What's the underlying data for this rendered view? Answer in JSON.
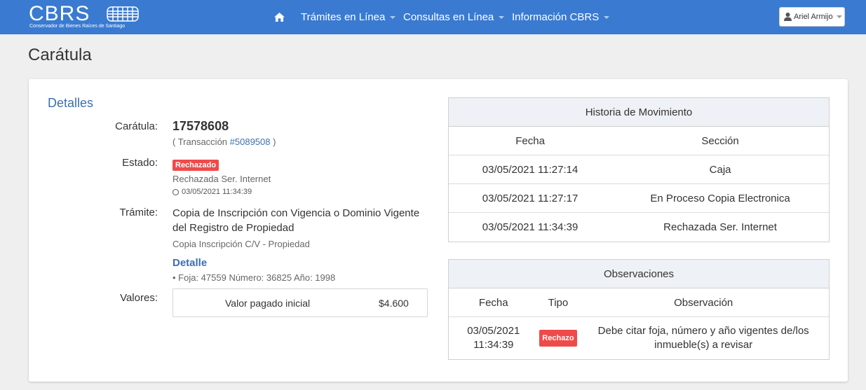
{
  "navbar": {
    "logo_text": "CBRS",
    "logo_subtitle": "Conservador de Bienes Raíces de Santiago",
    "home_icon": "home-icon",
    "menus": [
      "Trámites en Línea",
      "Consultas en Línea",
      "Información CBRS"
    ],
    "user_name": "Ariel Armijo",
    "user_icon": "user-icon"
  },
  "page": {
    "title": "Carátula",
    "section_title": "Detalles"
  },
  "details": {
    "caratula_label": "Carátula:",
    "caratula_number": "17578608",
    "transaccion_prefix": "( Transacción ",
    "transaccion_link": "#5089508",
    "transaccion_suffix": " )",
    "estado_label": "Estado:",
    "estado_badge": "Rechazado",
    "estado_detail": "Rechazada Ser. Internet",
    "estado_time": "03/05/2021 11:34:39",
    "tramite_label": "Trámite:",
    "tramite_title": "Copia de Inscripción con Vigencia o Dominio Vigente del Registro de Propiedad",
    "tramite_sub": "Copia Inscripción C/V - Propiedad",
    "detalle_heading": "Detalle",
    "detalle_text": "• Foja: 47559 Número: 36825 Año: 1998",
    "valores_label": "Valores:",
    "valor_name": "Valor pagado inicial",
    "valor_amount": "$4.600"
  },
  "historia": {
    "title": "Historia de Movimiento",
    "columns": [
      "Fecha",
      "Sección"
    ],
    "rows": [
      {
        "fecha": "03/05/2021 11:27:14",
        "seccion": "Caja"
      },
      {
        "fecha": "03/05/2021 11:27:17",
        "seccion": "En Proceso Copia Electronica"
      },
      {
        "fecha": "03/05/2021 11:34:39",
        "seccion": "Rechazada Ser. Internet"
      }
    ]
  },
  "observaciones": {
    "title": "Observaciones",
    "columns": [
      "Fecha",
      "Tipo",
      "Observación"
    ],
    "rows": [
      {
        "fecha_line1": "03/05/2021",
        "fecha_line2": "11:34:39",
        "tipo": "Rechazo",
        "obs_line1": "Debe citar foja, número y año vigentes de/los",
        "obs_line2": "inmueble(s) a revisar"
      }
    ]
  },
  "colors": {
    "navbar": "#3a7ad1",
    "link": "#3a6fb5",
    "badge_danger": "#ef4a4a"
  }
}
